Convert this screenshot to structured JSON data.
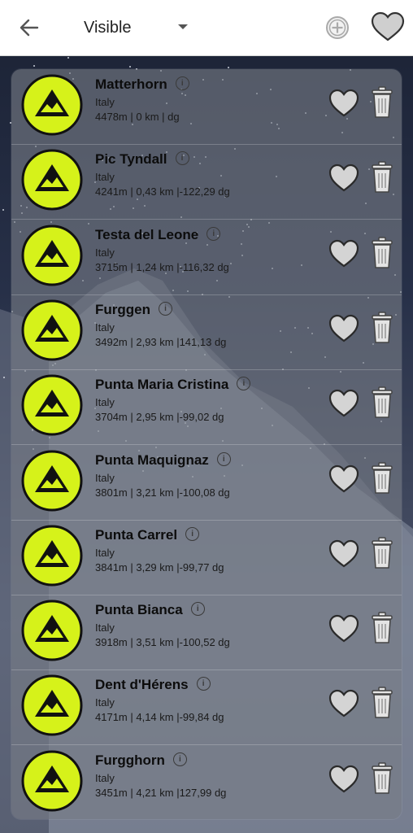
{
  "header": {
    "filter_value": "Visible",
    "back_icon": "arrow-left-icon",
    "dropdown_icon": "caret-down-icon",
    "add_icon": "plus-circle-icon",
    "favorites_icon": "heart-icon"
  },
  "colors": {
    "badge_fill": "#d6f21a",
    "badge_border": "#111111",
    "panel": "#787c86",
    "heart_fill": "#d4d4d4"
  },
  "peaks": [
    {
      "name": "Matterhorn",
      "country": "Italy",
      "meta": "4478m | 0 km | dg"
    },
    {
      "name": "Pic Tyndall",
      "country": "Italy",
      "meta": "4241m | 0,43 km |-122,29 dg"
    },
    {
      "name": "Testa del Leone",
      "country": "Italy",
      "meta": "3715m | 1,24 km |-116,32 dg"
    },
    {
      "name": "Furggen",
      "country": "Italy",
      "meta": "3492m | 2,93 km |141,13 dg"
    },
    {
      "name": "Punta Maria Cristina",
      "country": "Italy",
      "meta": "3704m | 2,95 km |-99,02 dg"
    },
    {
      "name": "Punta Maquignaz",
      "country": "Italy",
      "meta": "3801m | 3,21 km |-100,08 dg"
    },
    {
      "name": "Punta Carrel",
      "country": "Italy",
      "meta": "3841m | 3,29 km |-99,77 dg"
    },
    {
      "name": "Punta Bianca",
      "country": "Italy",
      "meta": "3918m | 3,51 km |-100,52 dg"
    },
    {
      "name": "Dent d'Hérens",
      "country": "Italy",
      "meta": "4171m | 4,14 km |-99,84 dg"
    },
    {
      "name": "Furgghorn",
      "country": "Italy",
      "meta": "3451m | 4,21 km |127,99 dg"
    }
  ]
}
